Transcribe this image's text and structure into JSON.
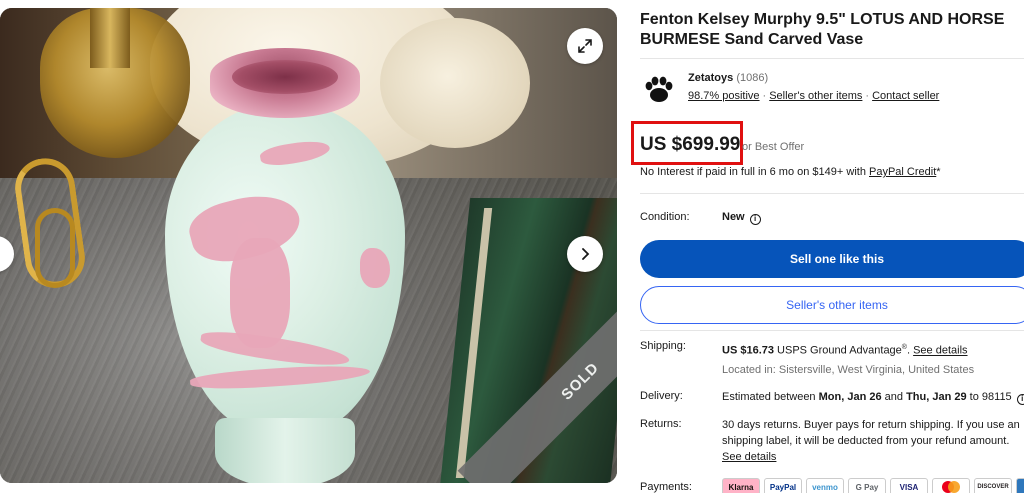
{
  "listing": {
    "title": "Fenton Kelsey Murphy 9.5\" LOTUS AND HORSE BURMESE Sand Carved Vase",
    "image_badge": "SOLD"
  },
  "seller": {
    "name": "Zetatoys",
    "feedback_count": "(1086)",
    "positive": "98.7% positive",
    "other_items_link": "Seller's other items",
    "contact_link": "Contact seller"
  },
  "price": {
    "amount": "US $699.99",
    "best_offer": "or Best Offer",
    "financing_text": "No Interest if paid in full in 6 mo on $149+ with",
    "financing_link": "PayPal Credit",
    "financing_suffix": "*"
  },
  "condition": {
    "label": "Condition:",
    "value": "New"
  },
  "buttons": {
    "sell_one": "Sell one like this",
    "other_items": "Seller's other items"
  },
  "shipping": {
    "label": "Shipping:",
    "cost": "US $16.73",
    "service": "USPS Ground Advantage",
    "reg_mark": "®",
    "period": ".",
    "details_link": "See details",
    "location": "Located in: Sistersville, West Virginia, United States"
  },
  "delivery": {
    "label": "Delivery:",
    "prefix": "Estimated between",
    "start": "Mon, Jan 26",
    "and": "and",
    "end": "Thu, Jan 29",
    "suffix": "to 98115"
  },
  "returns": {
    "label": "Returns:",
    "line1": "30 days returns. Buyer pays for return shipping. If you use an",
    "line2": "shipping label, it will be deducted from your refund amount.",
    "details_link": "See details"
  },
  "payments": {
    "label": "Payments:",
    "methods": [
      "Klarna",
      "PayPal",
      "venmo",
      "G Pay",
      "VISA",
      "MC",
      "DISCOVER",
      "AMEX"
    ]
  },
  "icons": {
    "expand": "expand-icon",
    "next": "chevron-right-icon",
    "prev": "chevron-left-icon",
    "info": "info-icon",
    "seller_logo": "paw-logo-icon"
  },
  "colors": {
    "primary_blue": "#0654ba",
    "link_blue": "#3665f3",
    "highlight_red": "#e01010",
    "text": "#191919",
    "muted": "#707070"
  }
}
